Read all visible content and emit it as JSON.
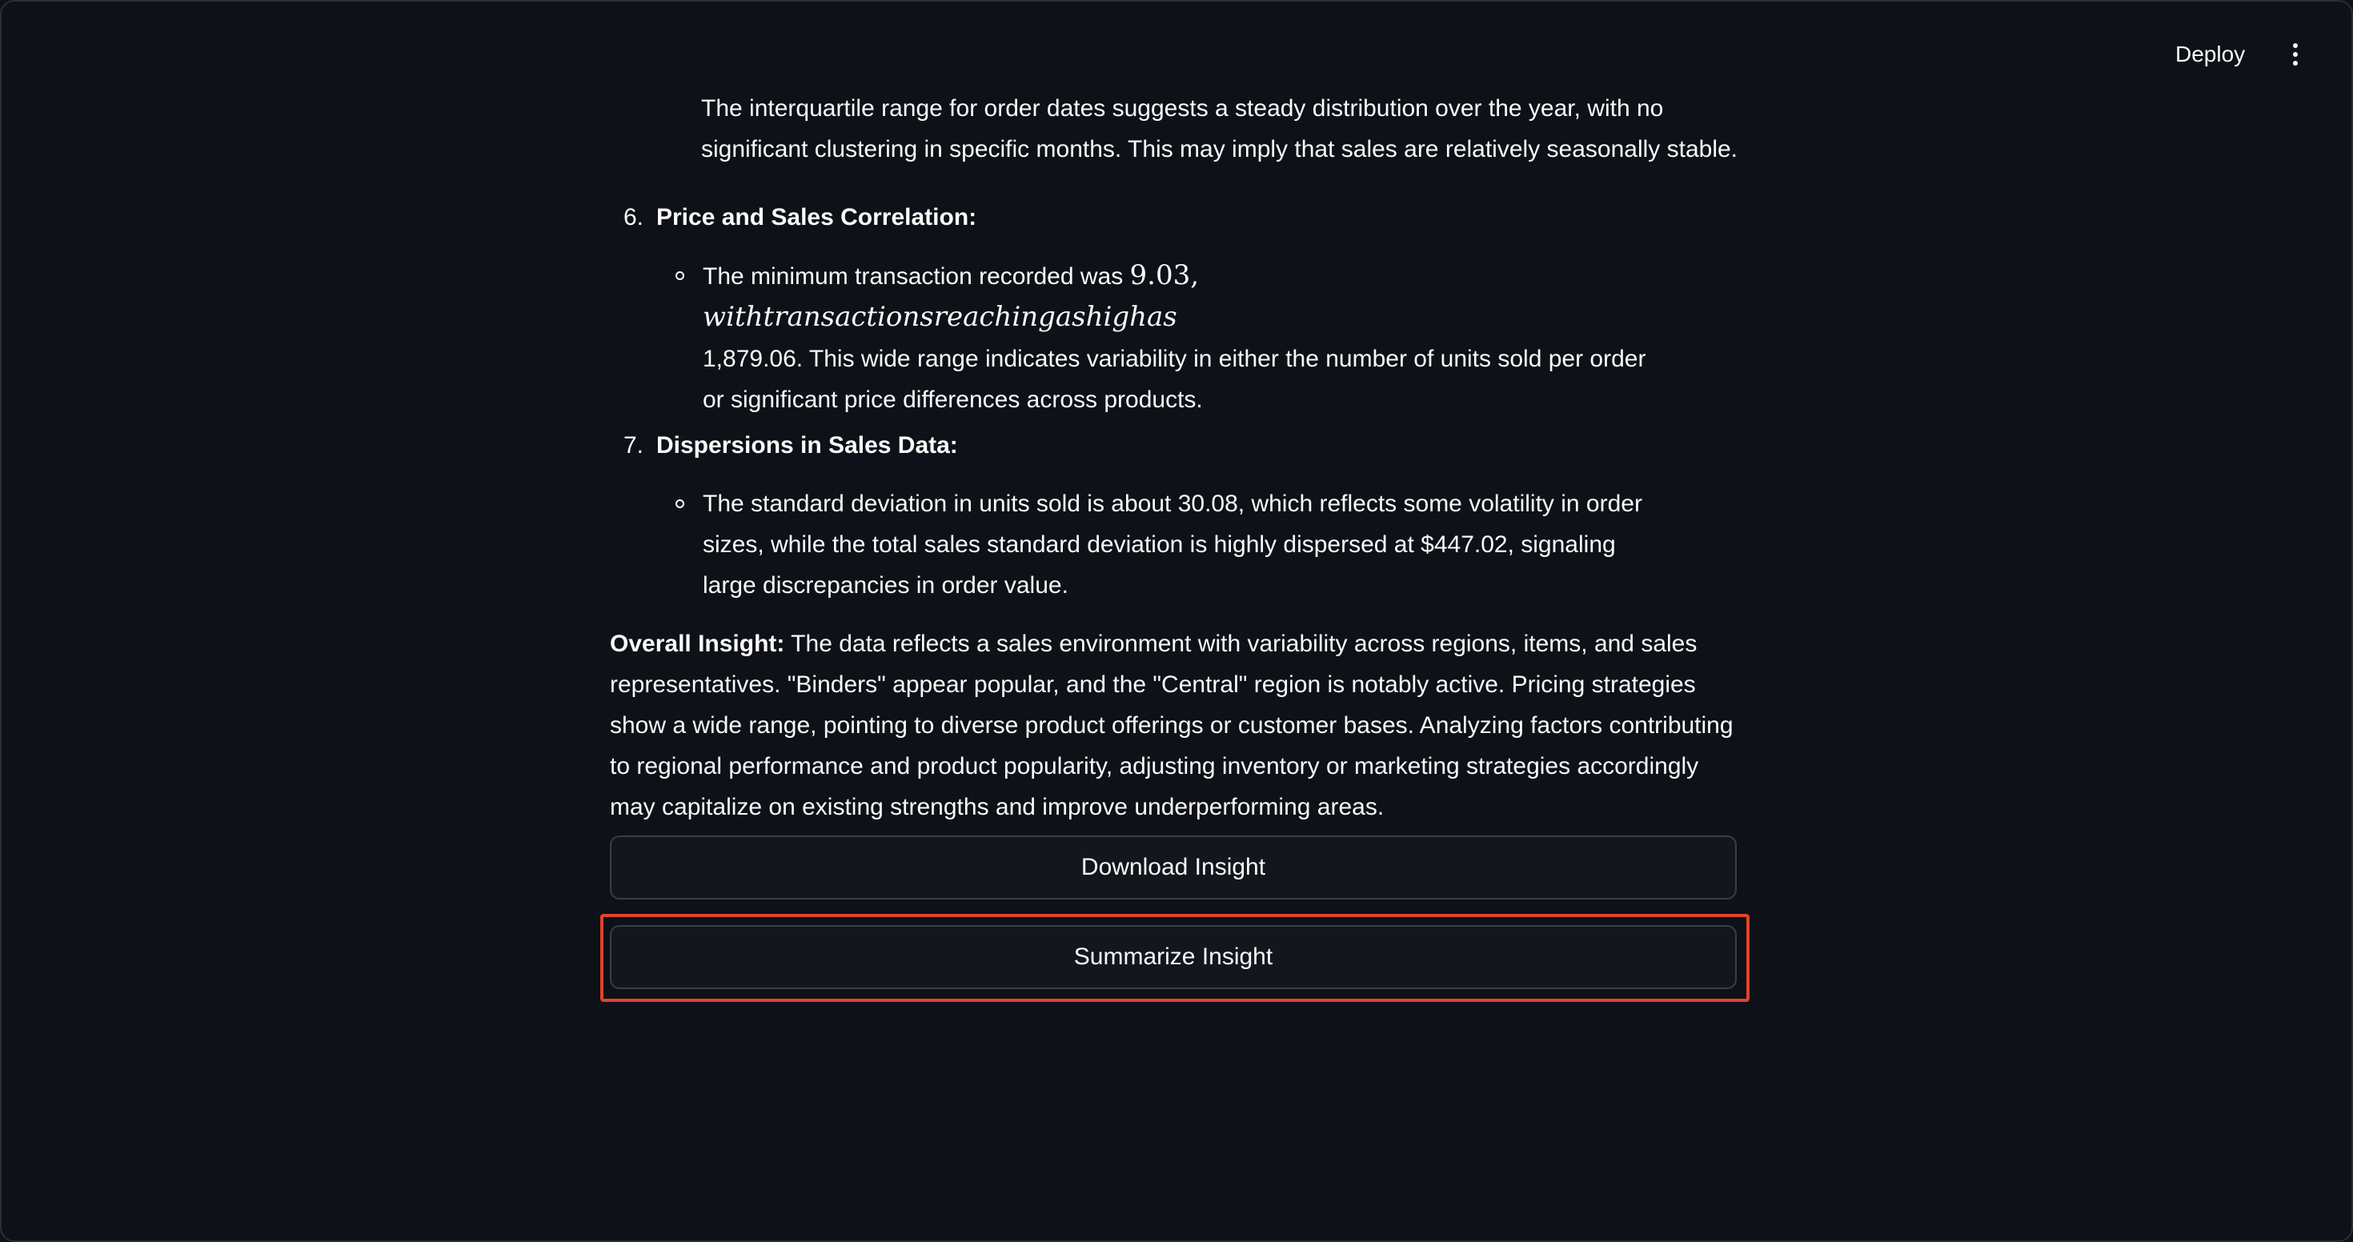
{
  "header": {
    "deploy_label": "Deploy"
  },
  "partial_paragraph": "The interquartile range for order dates suggests a steady distribution over the year, with no significant clustering in specific months. This may imply that sales are relatively seasonally stable.",
  "items": [
    {
      "number": "6.",
      "title": "Price and Sales Correlation:",
      "bullet_prefix": "The minimum transaction recorded was ",
      "bullet_math": "9.03,",
      "bullet_math_italic": " withtransactionsreachingashighas",
      "bullet_suffix": "1,879.06. This wide range indicates variability in either the number of units sold per order or significant price differences across products."
    },
    {
      "number": "7.",
      "title": "Dispersions in Sales Data:",
      "bullet_text": "The standard deviation in units sold is about 30.08, which reflects some volatility in order sizes, while the total sales standard deviation is highly dispersed at $447.02, signaling large discrepancies in order value."
    }
  ],
  "overall": {
    "label": "Overall Insight:",
    "text": " The data reflects a sales environment with variability across regions, items, and sales representatives. \"Binders\" appear popular, and the \"Central\" region is notably active. Pricing strategies show a wide range, pointing to diverse product offerings or customer bases. Analyzing factors contributing to regional performance and product popularity, adjusting inventory or marketing strategies accordingly may capitalize on existing strengths and improve underperforming areas."
  },
  "buttons": {
    "download_label": "Download Insight",
    "summarize_label": "Summarize Insight"
  },
  "colors": {
    "background": "#0e1117",
    "text": "#fafafa",
    "highlight": "#e0442b"
  }
}
